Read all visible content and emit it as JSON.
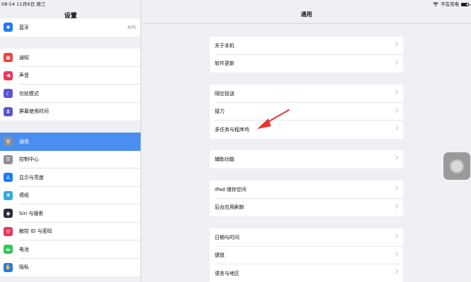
{
  "status_bar": {
    "time_date": "08:54  11月6日 周三",
    "charging_text": "不在充电",
    "battery_level": 0.8
  },
  "sidebar": {
    "title": "设置",
    "groups": [
      {
        "items": [
          {
            "label": "蓝牙",
            "value": "关闭",
            "icon": "bluetooth-icon",
            "color": "#1e7bf0",
            "glyph": "✱"
          }
        ]
      },
      {
        "items": [
          {
            "label": "通知",
            "icon": "notification-icon",
            "color": "#e8443a",
            "glyph": "▣"
          },
          {
            "label": "声音",
            "icon": "sound-icon",
            "color": "#e8375a",
            "glyph": "◀"
          },
          {
            "label": "勿扰模式",
            "icon": "moon-icon",
            "color": "#5b55d6",
            "glyph": "☾"
          },
          {
            "label": "屏幕使用时间",
            "icon": "hourglass-icon",
            "color": "#5b55d6",
            "glyph": "⧗"
          }
        ]
      },
      {
        "items": [
          {
            "label": "通用",
            "icon": "gear-icon",
            "color": "#8e8e93",
            "glyph": "⚙",
            "selected": true
          },
          {
            "label": "控制中心",
            "icon": "control-center-icon",
            "color": "#8e8e93",
            "glyph": "☰"
          },
          {
            "label": "显示与亮度",
            "icon": "display-icon",
            "color": "#1e7bf0",
            "glyph": "A"
          },
          {
            "label": "墙纸",
            "icon": "wallpaper-icon",
            "color": "#35aadc",
            "glyph": "❀"
          },
          {
            "label": "Siri 与搜索",
            "icon": "siri-icon",
            "color": "#2b2b3a",
            "glyph": "◉"
          },
          {
            "label": "触控 ID 与密码",
            "icon": "fingerprint-icon",
            "color": "#e8375a",
            "glyph": "◎"
          },
          {
            "label": "电池",
            "icon": "battery-icon",
            "color": "#35c759",
            "glyph": "▬"
          },
          {
            "label": "隐私",
            "icon": "privacy-hand-icon",
            "color": "#1e7bf0",
            "glyph": "✋"
          }
        ]
      }
    ]
  },
  "main": {
    "title": "通用",
    "groups": [
      {
        "items": [
          "关于本机",
          "软件更新"
        ]
      },
      {
        "items": [
          "隔空投送",
          "接力",
          "多任务与程序坞"
        ]
      },
      {
        "items": [
          "辅助功能"
        ]
      },
      {
        "items": [
          "iPad 储存空间",
          "后台应用刷新"
        ]
      },
      {
        "items": [
          "日期与时间",
          "键盘",
          "语言与地区"
        ]
      }
    ]
  },
  "colors": {
    "selection": "#4a8ef0",
    "annotation_arrow": "#e8352b"
  }
}
